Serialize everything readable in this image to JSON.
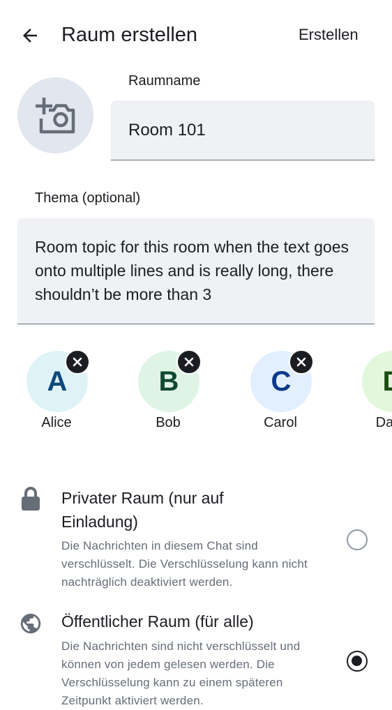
{
  "app_bar": {
    "title": "Raum erstellen",
    "action_label": "Erstellen",
    "back_icon": "arrow-back-icon"
  },
  "room_avatar": {
    "icon": "add-photo-camera-icon"
  },
  "room_name": {
    "label": "Raumname",
    "value": "Room 101"
  },
  "topic": {
    "label": "Thema (optional)",
    "value": "Room topic for this room when the text goes onto multiple lines and is really long, there shouldn’t be more than 3"
  },
  "invitees": [
    {
      "initial": "A",
      "name": "Alice",
      "bg": "#dff3f7",
      "fg": "#0e497c"
    },
    {
      "initial": "B",
      "name": "Bob",
      "bg": "#e0f4e6",
      "fg": "#0e4a33"
    },
    {
      "initial": "C",
      "name": "Carol",
      "bg": "#e2effe",
      "fg": "#0a3a8c"
    },
    {
      "initial": "D",
      "name": "Dave",
      "bg": "#e3f7dd",
      "fg": "#1b4d12"
    }
  ],
  "privacy_options": [
    {
      "icon": "lock-icon",
      "title": "Privater Raum (nur auf Einladung)",
      "description": "Die Nachrichten in diesem Chat sind verschlüsselt. Die Verschlüsselung kann nicht nachträglich deaktiviert werden.",
      "selected": false
    },
    {
      "icon": "globe-icon",
      "title": "Öffentlicher Raum (für alle)",
      "description": "Die Nachrichten sind nicht verschlüsselt und können von jedem gelesen werden. Die Verschlüsselung kann zu einem späteren Zeitpunkt aktiviert werden.",
      "selected": true
    }
  ],
  "colors": {
    "text_primary": "#1b1d22",
    "text_secondary": "#656d77",
    "field_bg": "#eff1f5",
    "avatar_placeholder_bg": "#e1e6ef"
  }
}
